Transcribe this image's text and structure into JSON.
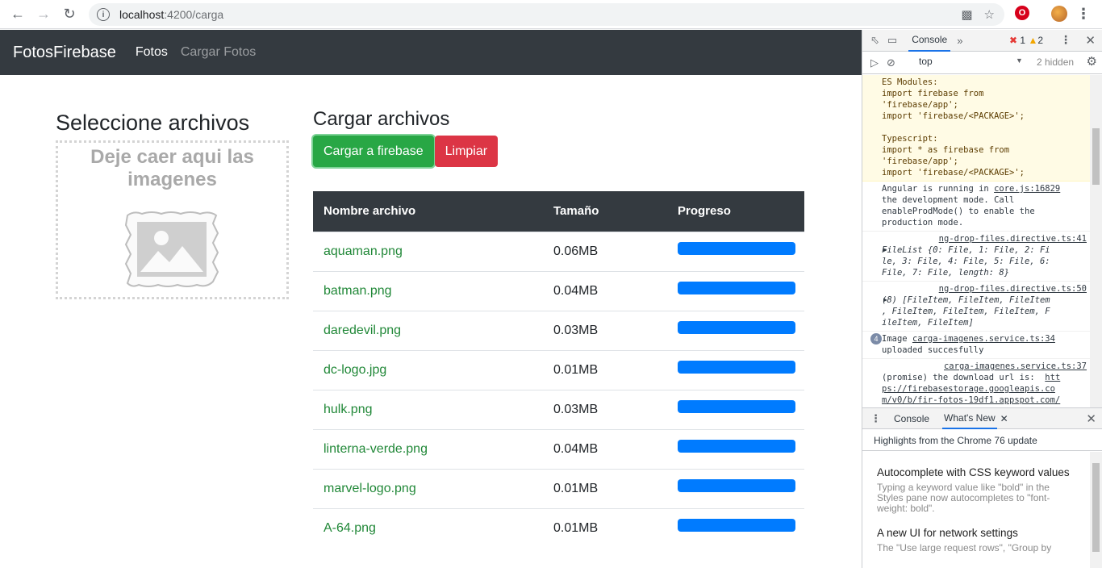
{
  "browser": {
    "url_host": "localhost",
    "url_rest": ":4200/carga"
  },
  "navbar": {
    "brand": "FotosFirebase",
    "links": [
      "Fotos",
      "Cargar Fotos"
    ]
  },
  "left": {
    "title": "Seleccione archivos",
    "drop_text": "Deje caer aqui las imagenes"
  },
  "right": {
    "title": "Cargar archivos",
    "upload_button": "Cargar a firebase",
    "clear_button": "Limpiar"
  },
  "table": {
    "headers": [
      "Nombre archivo",
      "Tamaño",
      "Progreso"
    ],
    "rows": [
      {
        "name": "aquaman.png",
        "size": "0.06MB",
        "progress": 100
      },
      {
        "name": "batman.png",
        "size": "0.04MB",
        "progress": 100
      },
      {
        "name": "daredevil.png",
        "size": "0.03MB",
        "progress": 100
      },
      {
        "name": "dc-logo.jpg",
        "size": "0.01MB",
        "progress": 100
      },
      {
        "name": "hulk.png",
        "size": "0.03MB",
        "progress": 100
      },
      {
        "name": "linterna-verde.png",
        "size": "0.04MB",
        "progress": 100
      },
      {
        "name": "marvel-logo.png",
        "size": "0.01MB",
        "progress": 100
      },
      {
        "name": "A-64.png",
        "size": "0.01MB",
        "progress": 100
      }
    ]
  },
  "devtools": {
    "tab_console": "Console",
    "errors": "1",
    "warnings": "2",
    "context": "top",
    "hidden": "2 hidden",
    "messages": {
      "warn_text": "ES Modules:\nimport firebase from\n'firebase/app';\nimport 'firebase/<PACKAGE>';\n\nTypescript:\nimport * as firebase from\n'firebase/app';\nimport 'firebase/<PACKAGE>';",
      "m1_src": "core.js:16829",
      "m1_text_a": "Angular is running in ",
      "m1_text_b": "the development mode. Call\nenableProdMode() to enable the\nproduction mode.",
      "m2_src": "ng-drop-files.directive.ts:41",
      "m2_text": "FileList {0: File, 1: File, 2: Fi\nle, 3: File, 4: File, 5: File, 6:\nFile, 7: File, length: 8}",
      "m3_src": "ng-drop-files.directive.ts:50",
      "m3_text": "(8) [FileItem, FileItem, FileItem\n, FileItem, FileItem, FileItem, F\nileItem, FileItem]",
      "m4_count": "4",
      "m4_text_a": "Image ",
      "m4_src": "carga-imagenes.service.ts:34",
      "m4_text_b": "uploaded succesfully",
      "m5_src": "carga-imagenes.service.ts:37",
      "m5_text": "(promise) the download url is:  ",
      "m5_link": "htt\nps://firebasestorage.googleapis.co\nm/v0/b/fir-fotos-19df1.appspot.com/"
    },
    "drawer": {
      "tab_console": "Console",
      "tab_whatsnew": "What's New",
      "highlights": "Highlights from the Chrome 76 update",
      "items": [
        {
          "title": "Autocomplete with CSS keyword values",
          "body": "Typing a keyword value like \"bold\" in the Styles pane now autocompletes to \"font-weight: bold\"."
        },
        {
          "title": "A new UI for network settings",
          "body": "The \"Use large request rows\", \"Group by"
        }
      ]
    }
  }
}
